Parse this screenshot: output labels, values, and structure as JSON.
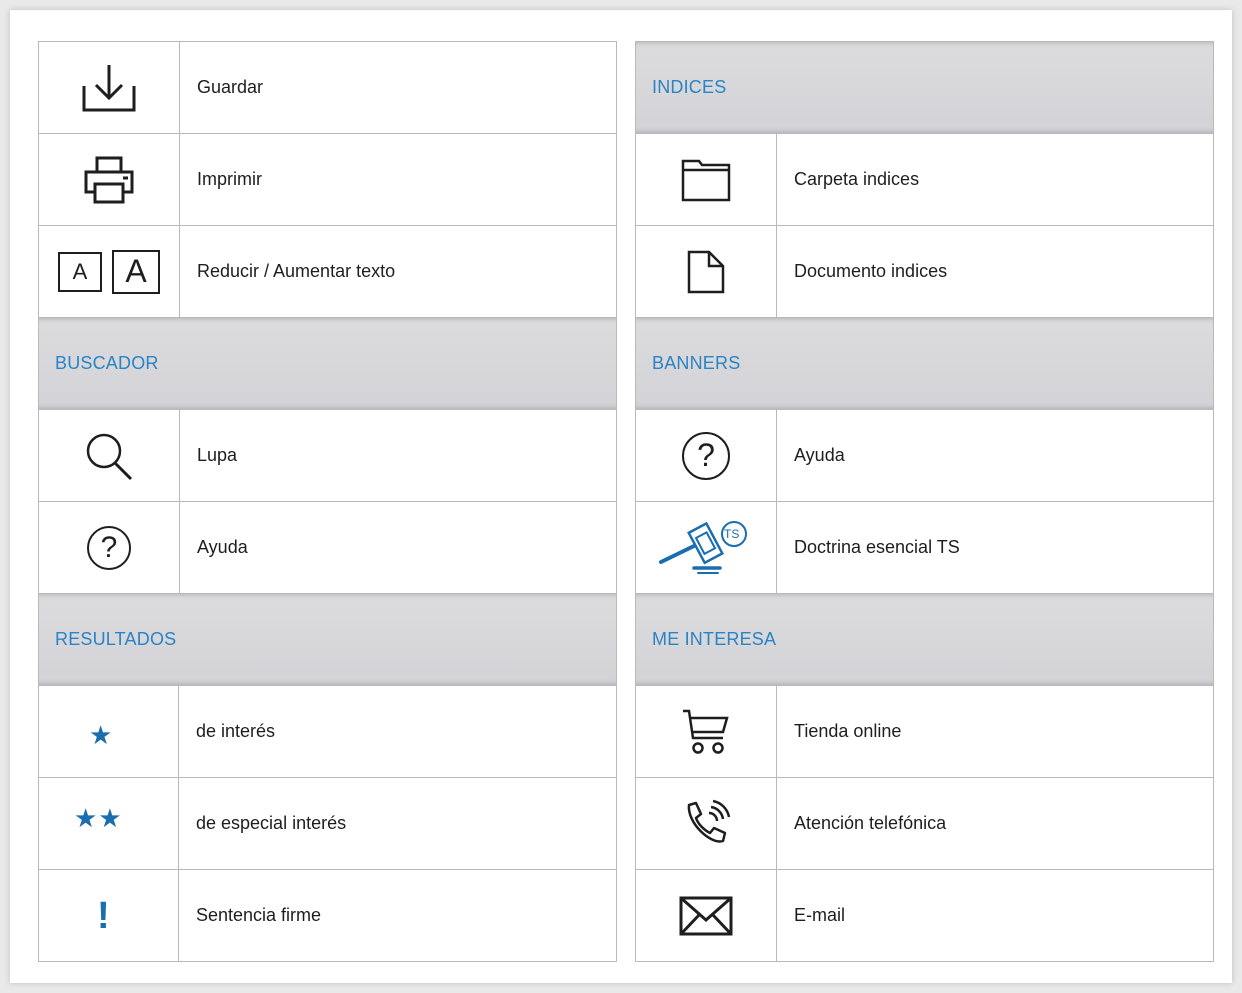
{
  "colors": {
    "accent": "#2a83c4",
    "text": "#1e1e1e",
    "section_bg": "#d8d8db"
  },
  "left": {
    "items_top": [
      {
        "icon": "download-icon",
        "label": "Guardar"
      },
      {
        "icon": "printer-icon",
        "label": "Imprimir"
      },
      {
        "icon": "text-size-icon",
        "label": "Reducir  / Aumentar texto",
        "icon_glyph_small": "A",
        "icon_glyph_large": "A"
      }
    ],
    "buscador": {
      "title": "BUSCADOR",
      "items": [
        {
          "icon": "magnifier-icon",
          "label": "Lupa"
        },
        {
          "icon": "help-icon",
          "label": "Ayuda",
          "glyph": "?"
        }
      ]
    },
    "resultados": {
      "title": "RESULTADOS",
      "items": [
        {
          "icon": "star-icon",
          "label": "de interés",
          "glyph": "★"
        },
        {
          "icon": "double-star-icon",
          "label": "de especial interés",
          "glyph": "★★"
        },
        {
          "icon": "exclamation-icon",
          "label": "Sentencia firme",
          "glyph": "!"
        }
      ]
    }
  },
  "right": {
    "indices": {
      "title": "INDICES",
      "items": [
        {
          "icon": "folder-icon",
          "label": "Carpeta indices"
        },
        {
          "icon": "document-icon",
          "label": "Documento indices"
        }
      ]
    },
    "banners": {
      "title": "BANNERS",
      "items": [
        {
          "icon": "help-icon",
          "label": "Ayuda",
          "glyph": "?"
        },
        {
          "icon": "gavel-ts-icon",
          "label": "Doctrina esencial TS",
          "badge": "TS"
        }
      ]
    },
    "me_interesa": {
      "title": "ME INTERESA",
      "items": [
        {
          "icon": "cart-icon",
          "label": "Tienda online"
        },
        {
          "icon": "phone-icon",
          "label": "Atención telefónica"
        },
        {
          "icon": "envelope-icon",
          "label": "E-mail"
        }
      ]
    }
  }
}
